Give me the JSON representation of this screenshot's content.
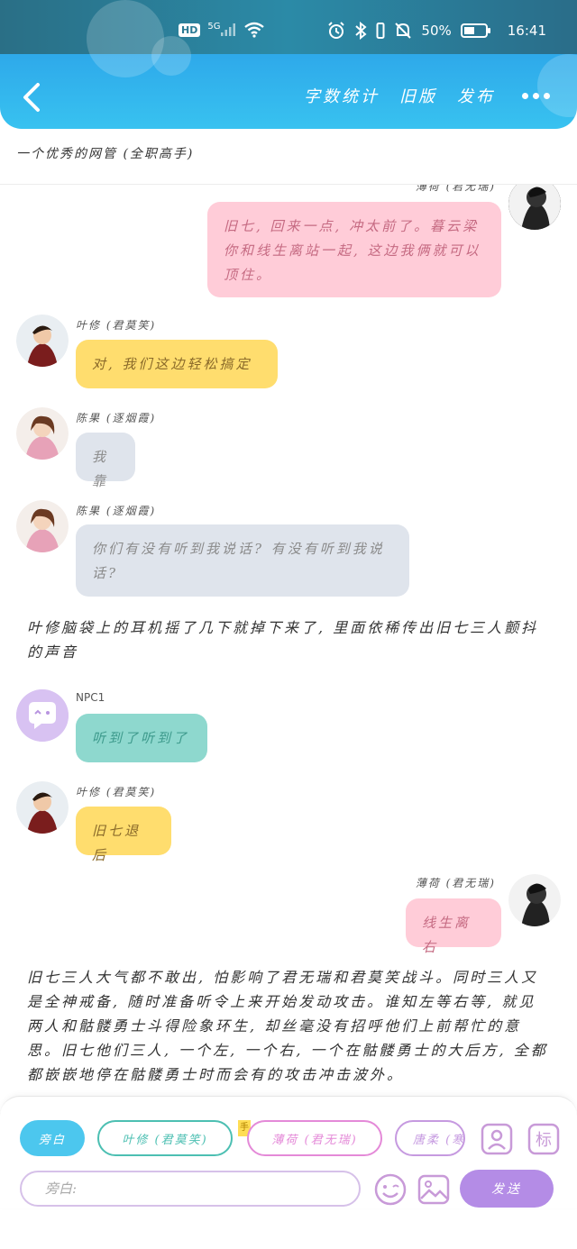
{
  "status_bar": {
    "hd": "HD",
    "network": "5G",
    "battery_percent": "50%",
    "time": "16:41"
  },
  "header": {
    "actions": [
      "字数统计",
      "旧版",
      "发布"
    ]
  },
  "subtitle": "一个优秀的网管 (全职高手)",
  "messages": {
    "m1": {
      "speaker": "薄荷 (君无瑞)",
      "text": "旧七, 回来一点, 冲太前了。暮云梁你和线生离站一起, 这边我俩就可以顶住。"
    },
    "m2": {
      "speaker": "叶修 (君莫笑)",
      "text": "对, 我们这边轻松搞定"
    },
    "m3": {
      "speaker": "陈果 (逐烟霞)",
      "text": "我靠"
    },
    "m4": {
      "speaker": "陈果 (逐烟霞)",
      "text": "你们有没有听到我说话? 有没有听到我说话?"
    },
    "narration1": "叶修脑袋上的耳机摇了几下就掉下来了, 里面依稀传出旧七三人颤抖的声音",
    "m5": {
      "speaker": "NPC1",
      "text": "听到了听到了"
    },
    "m6": {
      "speaker": "叶修 (君莫笑)",
      "text": "旧七退后"
    },
    "m7": {
      "speaker": "薄荷 (君无瑞)",
      "text": "线生离右"
    },
    "narration2": "旧七三人大气都不敢出, 怕影响了君无瑞和君莫笑战斗。同时三人又是全神戒备, 随时准备听令上来开始发动攻击。谁知左等右等, 就见两人和骷髅勇士斗得险象环生, 却丝毫没有招呼他们上前帮忙的意思。旧七他们三人, 一个左, 一个右, 一个在骷髅勇士的大后方, 全都都嵌嵌地停在骷髅勇士时而会有的攻击冲击波外。"
  },
  "bottom_bar": {
    "roles": [
      "旁白",
      "叶修 (君莫笑)",
      "薄荷 (君无瑞)",
      "唐柔 (寒烟柔)"
    ],
    "hand_badge": "手",
    "mark_label": "标",
    "input_placeholder": "旁白:",
    "send_label": "发送"
  },
  "colors": {
    "header_gradient": [
      "#1e8ac7",
      "#38c2f0"
    ],
    "pink_bubble": "#ffccd8",
    "yellow_bubble": "#ffdd6e",
    "gray_bubble": "#dfe4ec",
    "teal_bubble": "#8ed8ce",
    "send_button": "#b48ce6"
  },
  "icons": [
    "hd-badge",
    "signal-icon",
    "wifi-icon",
    "alarm-icon",
    "bluetooth-icon",
    "mute-bell-icon",
    "battery-icon",
    "back-arrow-icon",
    "more-dots-icon",
    "emoji-icon",
    "image-icon",
    "contact-card-icon",
    "mark-icon"
  ]
}
